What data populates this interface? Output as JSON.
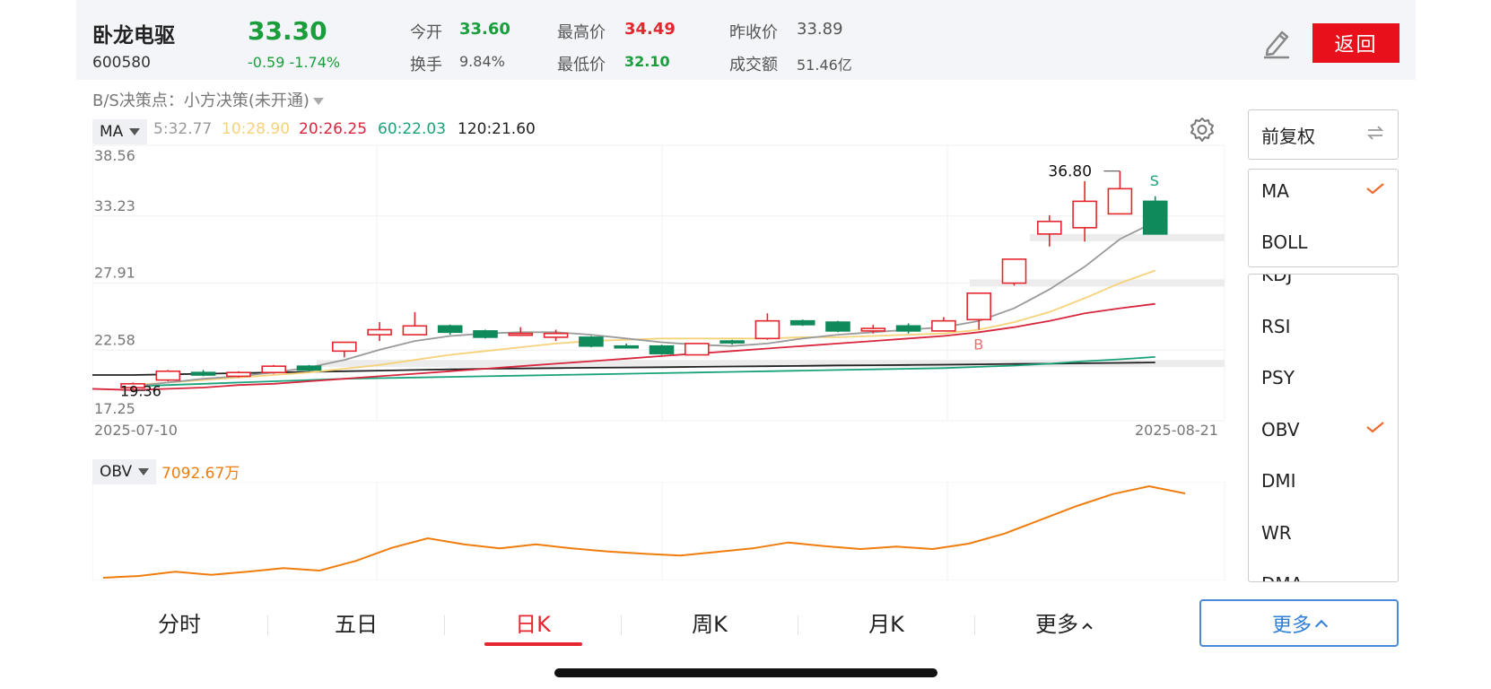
{
  "stock": {
    "name": "卧龙电驱",
    "code": "600580",
    "price": "33.30",
    "change": "-0.59 -1.74%"
  },
  "quote": {
    "open_label": "今开",
    "open": "33.60",
    "turnover_label": "换手",
    "turnover": "9.84%",
    "high_label": "最高价",
    "high": "34.49",
    "low_label": "最低价",
    "low": "32.10",
    "prev_close_label": "昨收价",
    "prev_close": "33.89",
    "amount_label": "成交额",
    "amount": "51.46亿"
  },
  "back_label": "返回",
  "decision": {
    "label": "B/S决策点：",
    "value": "小方决策(未开通)"
  },
  "ma_bar": {
    "indicator": "MA",
    "ma5": "5:32.77",
    "ma10": "10:28.90",
    "ma20": "20:26.25",
    "ma60": "60:22.03",
    "ma120": "120:21.60"
  },
  "obv_bar": {
    "indicator": "OBV",
    "value": "7092.67万"
  },
  "colors": {
    "up": "#e5262f",
    "down": "#0f8a5b",
    "ma5": "#9a9a9a",
    "ma10": "#f6d27a",
    "ma20": "#d7263d",
    "ma60": "#1aa37a",
    "ma120": "#222222",
    "obv": "#ef7d0e"
  },
  "chart_data": [
    {
      "type": "candlestick",
      "y_axis_ticks": [
        "38.56",
        "33.23",
        "27.91",
        "22.58",
        "17.25"
      ],
      "ylim": [
        17.25,
        38.56
      ],
      "x_start": "2025-07-10",
      "x_end": "2025-08-21",
      "max_label": "36.80",
      "min_label": "19.36",
      "signals": [
        {
          "label": "B",
          "index": 25
        },
        {
          "label": "S",
          "index": 30
        }
      ],
      "candles": [
        {
          "o": 19.6,
          "c": 19.9,
          "h": 20.0,
          "l": 19.36
        },
        {
          "o": 20.2,
          "c": 20.9,
          "h": 21.0,
          "l": 20.1
        },
        {
          "o": 20.8,
          "c": 20.6,
          "h": 21.0,
          "l": 20.5
        },
        {
          "o": 20.5,
          "c": 20.8,
          "h": 20.9,
          "l": 20.4
        },
        {
          "o": 20.8,
          "c": 21.3,
          "h": 21.4,
          "l": 20.7
        },
        {
          "o": 21.3,
          "c": 21.0,
          "h": 21.4,
          "l": 20.9
        },
        {
          "o": 22.5,
          "c": 23.2,
          "h": 23.2,
          "l": 22.0
        },
        {
          "o": 23.8,
          "c": 24.2,
          "h": 24.8,
          "l": 23.3
        },
        {
          "o": 23.8,
          "c": 24.5,
          "h": 25.6,
          "l": 23.8
        },
        {
          "o": 24.5,
          "c": 24.0,
          "h": 24.6,
          "l": 23.8
        },
        {
          "o": 24.1,
          "c": 23.6,
          "h": 24.2,
          "l": 23.5
        },
        {
          "o": 23.8,
          "c": 23.9,
          "h": 24.4,
          "l": 23.7
        },
        {
          "o": 23.6,
          "c": 23.9,
          "h": 24.2,
          "l": 23.3
        },
        {
          "o": 23.6,
          "c": 22.9,
          "h": 23.7,
          "l": 22.8
        },
        {
          "o": 22.9,
          "c": 22.8,
          "h": 23.1,
          "l": 22.7
        },
        {
          "o": 22.9,
          "c": 22.3,
          "h": 23.0,
          "l": 22.2
        },
        {
          "o": 22.2,
          "c": 23.1,
          "h": 23.1,
          "l": 22.2
        },
        {
          "o": 23.3,
          "c": 23.2,
          "h": 23.4,
          "l": 23.0
        },
        {
          "o": 23.5,
          "c": 24.9,
          "h": 25.5,
          "l": 23.4
        },
        {
          "o": 24.9,
          "c": 24.6,
          "h": 25.0,
          "l": 24.5
        },
        {
          "o": 24.8,
          "c": 24.1,
          "h": 24.9,
          "l": 24.0
        },
        {
          "o": 24.1,
          "c": 24.3,
          "h": 24.6,
          "l": 23.9
        },
        {
          "o": 24.5,
          "c": 24.1,
          "h": 24.7,
          "l": 23.9
        },
        {
          "o": 24.1,
          "c": 24.9,
          "h": 25.2,
          "l": 24.1
        },
        {
          "o": 25.0,
          "c": 27.1,
          "h": 27.1,
          "l": 24.2
        },
        {
          "o": 27.9,
          "c": 29.8,
          "h": 29.8,
          "l": 27.7
        },
        {
          "o": 31.8,
          "c": 32.8,
          "h": 33.3,
          "l": 30.8
        },
        {
          "o": 32.3,
          "c": 34.4,
          "h": 36.0,
          "l": 31.2
        },
        {
          "o": 33.4,
          "c": 35.4,
          "h": 36.8,
          "l": 33.4
        },
        {
          "o": 34.4,
          "c": 31.8,
          "h": 34.8,
          "l": 31.8
        }
      ],
      "ma5": [
        19.7,
        20.0,
        20.3,
        20.5,
        20.8,
        21.2,
        21.8,
        22.6,
        23.3,
        23.7,
        23.9,
        24.0,
        24.0,
        23.8,
        23.5,
        23.2,
        23.0,
        22.9,
        23.1,
        23.5,
        23.8,
        24.0,
        24.2,
        24.4,
        24.9,
        25.9,
        27.4,
        29.2,
        31.4,
        32.77
      ],
      "ma10": [
        19.8,
        20.0,
        20.2,
        20.4,
        20.6,
        20.8,
        21.1,
        21.4,
        21.8,
        22.2,
        22.5,
        22.8,
        23.1,
        23.3,
        23.4,
        23.5,
        23.5,
        23.5,
        23.5,
        23.6,
        23.6,
        23.7,
        23.8,
        23.9,
        24.2,
        24.8,
        25.6,
        26.7,
        27.9,
        28.9
      ],
      "ma20": [
        19.4,
        19.5,
        19.6,
        19.8,
        19.9,
        20.1,
        20.3,
        20.5,
        20.7,
        20.9,
        21.1,
        21.3,
        21.5,
        21.7,
        21.9,
        22.1,
        22.3,
        22.5,
        22.7,
        22.9,
        23.1,
        23.3,
        23.5,
        23.7,
        24.0,
        24.4,
        24.9,
        25.5,
        25.9,
        26.25
      ],
      "ma60": [
        19.7,
        19.8,
        19.9,
        20.0,
        20.1,
        20.2,
        20.3,
        20.35,
        20.4,
        20.45,
        20.5,
        20.55,
        20.6,
        20.65,
        20.7,
        20.75,
        20.8,
        20.85,
        20.9,
        20.95,
        21.0,
        21.05,
        21.1,
        21.15,
        21.25,
        21.35,
        21.5,
        21.7,
        21.85,
        22.03
      ],
      "ma120": [
        20.6,
        20.65,
        20.7,
        20.75,
        20.8,
        20.85,
        20.9,
        20.95,
        21.0,
        21.05,
        21.1,
        21.12,
        21.15,
        21.18,
        21.2,
        21.22,
        21.25,
        21.28,
        21.3,
        21.33,
        21.36,
        21.38,
        21.4,
        21.42,
        21.45,
        21.48,
        21.5,
        21.53,
        21.56,
        21.6
      ]
    },
    {
      "type": "line",
      "series": [
        {
          "name": "OBV",
          "values": [
            0.0,
            0.3,
            1.0,
            0.5,
            1.0,
            1.6,
            1.2,
            2.8,
            5.0,
            6.6,
            5.6,
            4.9,
            5.6,
            4.9,
            4.4,
            4.0,
            3.7,
            4.3,
            4.9,
            5.9,
            5.3,
            4.8,
            5.2,
            4.8,
            5.7,
            7.4,
            9.7,
            12.0,
            14.0,
            15.3,
            14.1
          ]
        }
      ]
    }
  ],
  "fuquan_label": "前复权",
  "indicators_top": [
    {
      "label": "MA",
      "checked": true
    },
    {
      "label": "BOLL",
      "checked": false
    }
  ],
  "indicators_list": [
    {
      "label": "KDJ",
      "checked": false
    },
    {
      "label": "RSI",
      "checked": false
    },
    {
      "label": "PSY",
      "checked": false
    },
    {
      "label": "OBV",
      "checked": true
    },
    {
      "label": "DMI",
      "checked": false
    },
    {
      "label": "WR",
      "checked": false
    },
    {
      "label": "DMA",
      "checked": false
    }
  ],
  "tabs": [
    {
      "label": "分时",
      "active": false
    },
    {
      "label": "五日",
      "active": false
    },
    {
      "label": "日K",
      "active": true
    },
    {
      "label": "周K",
      "active": false
    },
    {
      "label": "月K",
      "active": false
    },
    {
      "label": "更多",
      "active": false
    }
  ],
  "more_button_label": "更多"
}
